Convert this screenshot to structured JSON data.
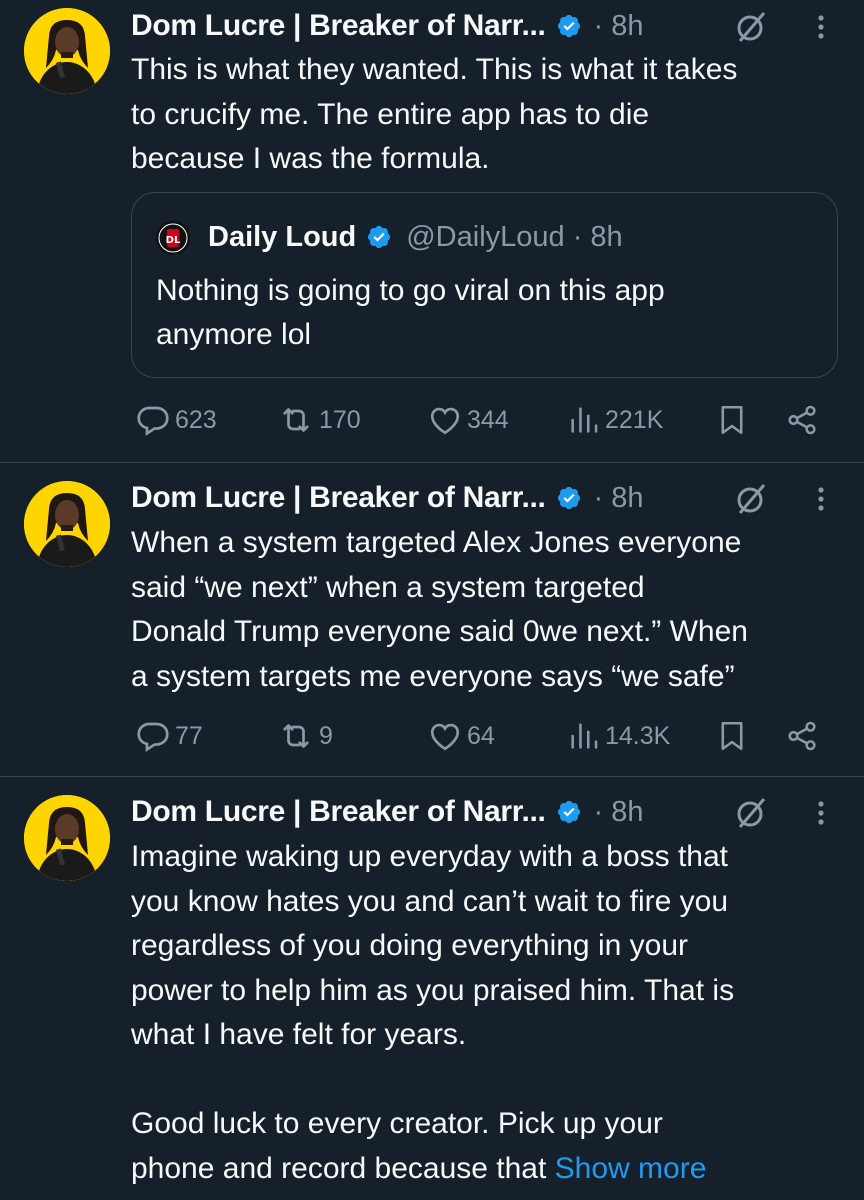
{
  "colors": {
    "background": "#15202b",
    "text": "#f7f9f9",
    "muted": "#8b98a5",
    "accent": "#1d9bf0",
    "border": "#38444d",
    "avatar_bg": "#ffd500"
  },
  "icons": {
    "verified": "verified-badge-icon",
    "grok": "grok-icon",
    "more": "more-vertical-icon",
    "reply": "reply-icon",
    "repost": "repost-icon",
    "like": "like-icon",
    "views": "views-icon",
    "bookmark": "bookmark-icon",
    "share": "share-icon"
  },
  "tweets": [
    {
      "author": "Dom Lucre | Breaker of Narr...",
      "time": "· 8h",
      "text": "This is what they wanted. This is what it takes\nto crucify me. The entire app has to die\nbecause I was the formula.",
      "quote": {
        "author": "Daily Loud",
        "handle": "@DailyLoud · 8h",
        "text": "Nothing is going to go viral on this app\nanymore lol"
      },
      "replies": "623",
      "reposts": "170",
      "likes": "344",
      "views": "221K"
    },
    {
      "author": "Dom Lucre | Breaker of Narr...",
      "time": "· 8h",
      "text": "When a system targeted Alex Jones everyone\nsaid “we next” when a system targeted\nDonald Trump everyone said 0we next.” When\na system targets me everyone says “we safe”",
      "replies": "77",
      "reposts": "9",
      "likes": "64",
      "views": "14.3K"
    },
    {
      "author": "Dom Lucre | Breaker of Narr...",
      "time": "· 8h",
      "text": "Imagine waking up everyday with a boss that\nyou know hates you and can’t wait to fire you\nregardless of you doing everything in your\npower to help him as you praised him. That is\nwhat I have felt for years.\n\nGood luck to every creator. Pick up your\nphone and record because that ",
      "show_more": "Show more"
    }
  ]
}
